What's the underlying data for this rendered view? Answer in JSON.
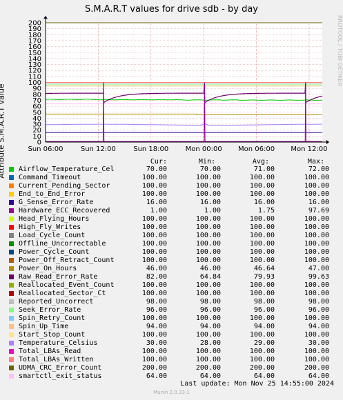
{
  "chart_data": {
    "type": "line",
    "title": "S.M.A.R.T values for drive sdb - by day",
    "ylabel": "Attribute S.M.A.R.T value",
    "ylim": [
      0,
      200
    ],
    "yticks": [
      0,
      10,
      20,
      30,
      40,
      50,
      60,
      70,
      80,
      90,
      100,
      110,
      120,
      130,
      140,
      150,
      160,
      170,
      180,
      190,
      200
    ],
    "x_range_hours": [
      0,
      31.5
    ],
    "xticks": [
      {
        "label": "Sun 06:00",
        "hour": 0
      },
      {
        "label": "Sun 12:00",
        "hour": 6
      },
      {
        "label": "Sun 18:00",
        "hour": 12
      },
      {
        "label": "Mon 00:00",
        "hour": 18
      },
      {
        "label": "Mon 06:00",
        "hour": 24
      },
      {
        "label": "Mon 12:00",
        "hour": 30
      }
    ],
    "grid": true,
    "legend_position": "bottom",
    "column_headers": {
      "cur": "Cur:",
      "min": "Min:",
      "avg": "Avg:",
      "max": "Max:"
    },
    "series": [
      {
        "name": "Airflow_Temperature_Cel",
        "color": "#00cc00",
        "cur": "70.00",
        "min": "70.00",
        "avg": "71.00",
        "max": "72.00"
      },
      {
        "name": "Command_Timeout",
        "color": "#0066b3",
        "cur": "100.00",
        "min": "100.00",
        "avg": "100.00",
        "max": "100.00"
      },
      {
        "name": "Current_Pending_Sector",
        "color": "#ff8000",
        "cur": "100.00",
        "min": "100.00",
        "avg": "100.00",
        "max": "100.00"
      },
      {
        "name": "End_to_End_Error",
        "color": "#ffcc00",
        "cur": "100.00",
        "min": "100.00",
        "avg": "100.00",
        "max": "100.00"
      },
      {
        "name": "G_Sense_Error_Rate",
        "color": "#330099",
        "cur": "16.00",
        "min": "16.00",
        "avg": "16.00",
        "max": "16.00"
      },
      {
        "name": "Hardware_ECC_Recovered",
        "color": "#990099",
        "cur": "1.00",
        "min": "1.00",
        "avg": "1.75",
        "max": "97.69"
      },
      {
        "name": "Head_Flying_Hours",
        "color": "#ccff00",
        "cur": "100.00",
        "min": "100.00",
        "avg": "100.00",
        "max": "100.00"
      },
      {
        "name": "High_Fly_Writes",
        "color": "#ff0000",
        "cur": "100.00",
        "min": "100.00",
        "avg": "100.00",
        "max": "100.00"
      },
      {
        "name": "Load_Cycle_Count",
        "color": "#808080",
        "cur": "100.00",
        "min": "100.00",
        "avg": "100.00",
        "max": "100.00"
      },
      {
        "name": "Offline_Uncorrectable",
        "color": "#008f00",
        "cur": "100.00",
        "min": "100.00",
        "avg": "100.00",
        "max": "100.00"
      },
      {
        "name": "Power_Cycle_Count",
        "color": "#00487d",
        "cur": "100.00",
        "min": "100.00",
        "avg": "100.00",
        "max": "100.00"
      },
      {
        "name": "Power_Off_Retract_Count",
        "color": "#b35a00",
        "cur": "100.00",
        "min": "100.00",
        "avg": "100.00",
        "max": "100.00"
      },
      {
        "name": "Power_On_Hours",
        "color": "#b38f00",
        "cur": "46.00",
        "min": "46.00",
        "avg": "46.64",
        "max": "47.00"
      },
      {
        "name": "Raw_Read_Error_Rate",
        "color": "#6b006b",
        "cur": "82.00",
        "min": "64.84",
        "avg": "79.93",
        "max": "99.63"
      },
      {
        "name": "Reallocated_Event_Count",
        "color": "#8fb300",
        "cur": "100.00",
        "min": "100.00",
        "avg": "100.00",
        "max": "100.00"
      },
      {
        "name": "Reallocated_Sector_Ct",
        "color": "#b30000",
        "cur": "100.00",
        "min": "100.00",
        "avg": "100.00",
        "max": "100.00"
      },
      {
        "name": "Reported_Uncorrect",
        "color": "#bebebe",
        "cur": "98.00",
        "min": "98.00",
        "avg": "98.00",
        "max": "98.00"
      },
      {
        "name": "Seek_Error_Rate",
        "color": "#80ff80",
        "cur": "96.00",
        "min": "96.00",
        "avg": "96.00",
        "max": "96.00"
      },
      {
        "name": "Spin_Retry_Count",
        "color": "#80c9ff",
        "cur": "100.00",
        "min": "100.00",
        "avg": "100.00",
        "max": "100.00"
      },
      {
        "name": "Spin_Up_Time",
        "color": "#ffc080",
        "cur": "94.00",
        "min": "94.00",
        "avg": "94.00",
        "max": "94.00"
      },
      {
        "name": "Start_Stop_Count",
        "color": "#ffe680",
        "cur": "100.00",
        "min": "100.00",
        "avg": "100.00",
        "max": "100.00"
      },
      {
        "name": "Temperature_Celsius",
        "color": "#aa80ff",
        "cur": "30.00",
        "min": "28.00",
        "avg": "29.00",
        "max": "30.00"
      },
      {
        "name": "Total_LBAs_Read",
        "color": "#ee00cc",
        "cur": "100.00",
        "min": "100.00",
        "avg": "100.00",
        "max": "100.00"
      },
      {
        "name": "Total_LBAs_Written",
        "color": "#ff8080",
        "cur": "100.00",
        "min": "100.00",
        "avg": "100.00",
        "max": "100.00"
      },
      {
        "name": "UDMA_CRC_Error_Count",
        "color": "#666600",
        "cur": "200.00",
        "min": "200.00",
        "avg": "200.00",
        "max": "200.00"
      },
      {
        "name": "smartctl_exit_status",
        "color": "#ffbfff",
        "cur": "64.00",
        "min": "64.00",
        "avg": "64.00",
        "max": "64.00"
      }
    ],
    "spike_hours": [
      6.6,
      18.1,
      29.6
    ]
  },
  "footer": {
    "last_update": "Last update:  Mon Nov 25 14:55:00 2024",
    "munin_version": "Munin 2.0.33-1"
  },
  "watermark": "RRDTOOL / TOBI OETIKER"
}
